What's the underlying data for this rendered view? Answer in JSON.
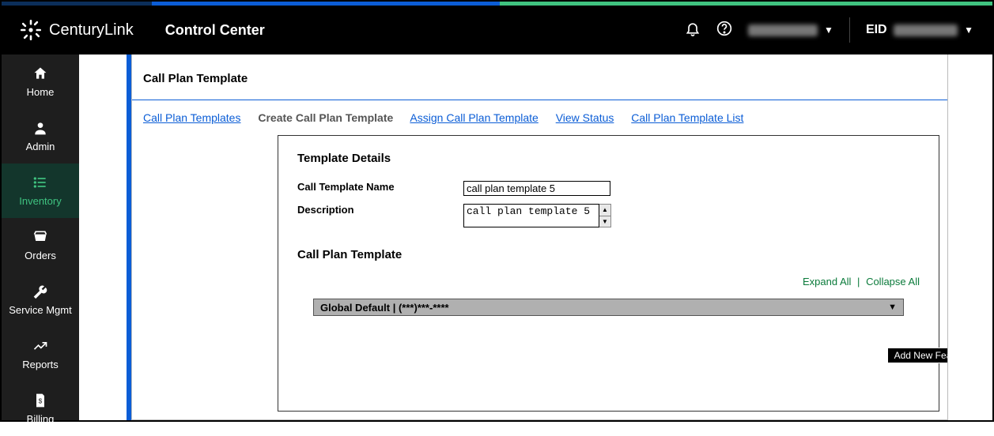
{
  "brand": {
    "name": "CenturyLink",
    "app": "Control Center"
  },
  "header": {
    "eid_label": "EID",
    "user_blur": "xxxxxxxx",
    "eid_blur": "xxxxxxx"
  },
  "sidebar": {
    "items": [
      {
        "label": "Home"
      },
      {
        "label": "Admin"
      },
      {
        "label": "Inventory"
      },
      {
        "label": "Orders"
      },
      {
        "label": "Service Mgmt"
      },
      {
        "label": "Reports"
      },
      {
        "label": "Billing"
      }
    ]
  },
  "page": {
    "title": "Call Plan Template",
    "tabs": [
      {
        "label": "Call Plan Templates"
      },
      {
        "label": "Create Call Plan Template"
      },
      {
        "label": "Assign Call Plan Template"
      },
      {
        "label": "View Status"
      },
      {
        "label": "Call Plan Template List"
      }
    ],
    "active_tab_index": 1,
    "sections": {
      "details_heading": "Template Details",
      "name_label": "Call Template Name",
      "name_value": "call plan template 5",
      "desc_label": "Description",
      "desc_value": "call plan template 5",
      "plan_heading": "Call Plan Template",
      "expand_all": "Expand All",
      "collapse_all": "Collapse All",
      "accordion_label": "Global Default | (***)***-****",
      "tooltip": "Add New Feature"
    }
  }
}
